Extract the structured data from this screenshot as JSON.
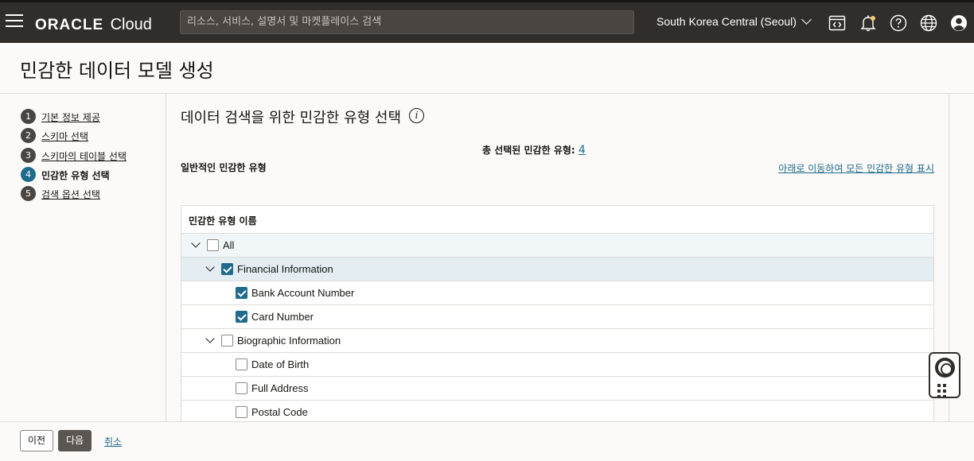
{
  "topbar": {
    "logo_brand": "ORACLE",
    "logo_product": "Cloud",
    "search_placeholder": "리소스, 서비스, 설명서 및 마켓플레이스 검색",
    "region": "South Korea Central (Seoul)",
    "icons": [
      "menu-icon",
      "code-editor-icon",
      "bell-icon",
      "help-icon",
      "globe-icon",
      "user-icon"
    ]
  },
  "page": {
    "title": "민감한 데이터 모델 생성"
  },
  "steps": [
    {
      "num": "1",
      "label": "기본 정보 제공",
      "active": false
    },
    {
      "num": "2",
      "label": "스키마 선택",
      "active": false
    },
    {
      "num": "3",
      "label": "스키마의 테이블 선택",
      "active": false
    },
    {
      "num": "4",
      "label": "민감한 유형 선택",
      "active": true
    },
    {
      "num": "5",
      "label": "검색 옵션 선택",
      "active": false
    }
  ],
  "main": {
    "heading": "데이터 검색을 위한 민감한 유형 선택",
    "info_glyph": "i",
    "total_label": "총 선택된 민감한 유형:",
    "total_count": "4",
    "common_label": "일반적인 민감한 유형",
    "show_all_link": "아래로 이동하여 모든 민감한 유형 표시",
    "table": {
      "column_header": "민감한 유형 이름",
      "rows": [
        {
          "label": "All",
          "level": 0,
          "expandable": true,
          "checked": false
        },
        {
          "label": "Financial Information",
          "level": 1,
          "expandable": true,
          "checked": true
        },
        {
          "label": "Bank Account Number",
          "level": 2,
          "expandable": false,
          "checked": true
        },
        {
          "label": "Card Number",
          "level": 2,
          "expandable": false,
          "checked": true
        },
        {
          "label": "Biographic Information",
          "level": 1,
          "expandable": true,
          "checked": false
        },
        {
          "label": "Date of Birth",
          "level": 2,
          "expandable": false,
          "checked": false
        },
        {
          "label": "Full Address",
          "level": 2,
          "expandable": false,
          "checked": false
        },
        {
          "label": "Postal Code",
          "level": 2,
          "expandable": false,
          "checked": false
        }
      ]
    }
  },
  "footer": {
    "prev_label": "이전",
    "next_label": "다음",
    "cancel_label": "취소"
  },
  "colors": {
    "topbar_bg": "#312d2a",
    "accent": "#1e6b8c",
    "selected_row_bg": "#e4eef2"
  }
}
